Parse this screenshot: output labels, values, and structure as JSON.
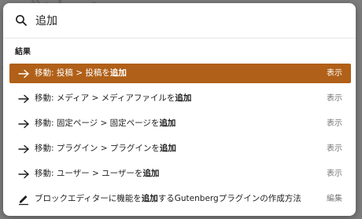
{
  "search": {
    "value": "追加"
  },
  "group_label": "結果",
  "results": [
    {
      "icon": "arrow-right-icon",
      "prefix": "移動: 投稿 > 投稿を",
      "match": "追加",
      "suffix": "",
      "action": "表示",
      "selected": true
    },
    {
      "icon": "arrow-right-icon",
      "prefix": "移動: メディア > メディアファイルを",
      "match": "追加",
      "suffix": "",
      "action": "表示",
      "selected": false
    },
    {
      "icon": "arrow-right-icon",
      "prefix": "移動: 固定ページ > 固定ページを",
      "match": "追加",
      "suffix": "",
      "action": "表示",
      "selected": false
    },
    {
      "icon": "arrow-right-icon",
      "prefix": "移動: プラグイン > プラグインを",
      "match": "追加",
      "suffix": "",
      "action": "表示",
      "selected": false
    },
    {
      "icon": "arrow-right-icon",
      "prefix": "移動: ユーザー > ユーザーを",
      "match": "追加",
      "suffix": "",
      "action": "表示",
      "selected": false
    },
    {
      "icon": "edit-post-icon",
      "prefix": "ブロックエディターに機能を",
      "match": "追加",
      "suffix": "するGutenbergプラグインの作成方法",
      "action": "編集",
      "selected": false
    }
  ],
  "colors": {
    "selected_background": "#b06018",
    "selected_text": "#ffffff",
    "action_text": "#757575"
  }
}
